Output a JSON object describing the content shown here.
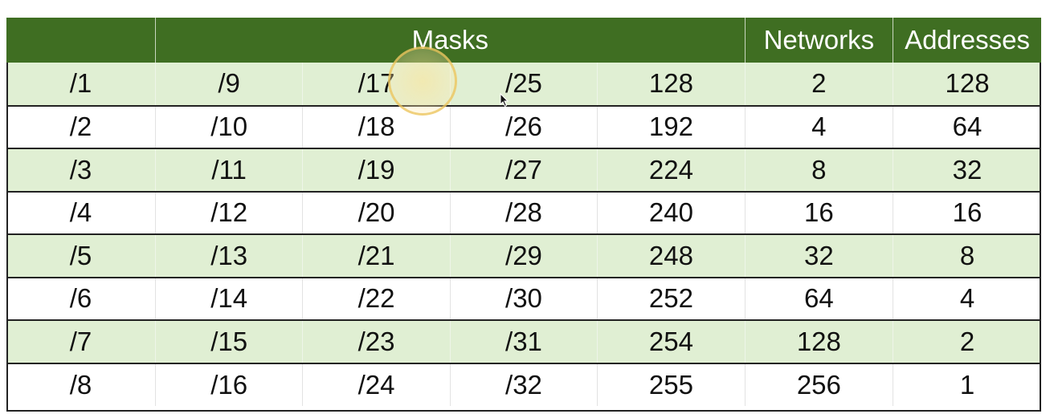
{
  "header": {
    "corner": "",
    "masks": "Masks",
    "networks": "Networks",
    "addresses": "Addresses"
  },
  "rows": [
    {
      "c1": "/1",
      "c2": "/9",
      "c3": "/17",
      "c4": "/25",
      "mask": "128",
      "networks": "2",
      "addresses": "128"
    },
    {
      "c1": "/2",
      "c2": "/10",
      "c3": "/18",
      "c4": "/26",
      "mask": "192",
      "networks": "4",
      "addresses": "64"
    },
    {
      "c1": "/3",
      "c2": "/11",
      "c3": "/19",
      "c4": "/27",
      "mask": "224",
      "networks": "8",
      "addresses": "32"
    },
    {
      "c1": "/4",
      "c2": "/12",
      "c3": "/20",
      "c4": "/28",
      "mask": "240",
      "networks": "16",
      "addresses": "16"
    },
    {
      "c1": "/5",
      "c2": "/13",
      "c3": "/21",
      "c4": "/29",
      "mask": "248",
      "networks": "32",
      "addresses": "8"
    },
    {
      "c1": "/6",
      "c2": "/14",
      "c3": "/22",
      "c4": "/30",
      "mask": "252",
      "networks": "64",
      "addresses": "4"
    },
    {
      "c1": "/7",
      "c2": "/15",
      "c3": "/23",
      "c4": "/31",
      "mask": "254",
      "networks": "128",
      "addresses": "2"
    },
    {
      "c1": "/8",
      "c2": "/16",
      "c3": "/24",
      "c4": "/32",
      "mask": "255",
      "networks": "256",
      "addresses": "1"
    }
  ],
  "colors": {
    "header_bg": "#3f6e22",
    "band_light_green": "#e0efd3",
    "band_white": "#ffffff",
    "highlight": "#ebc35a"
  },
  "icons": [
    "mouse-pointer-icon",
    "click-highlight-ring"
  ]
}
